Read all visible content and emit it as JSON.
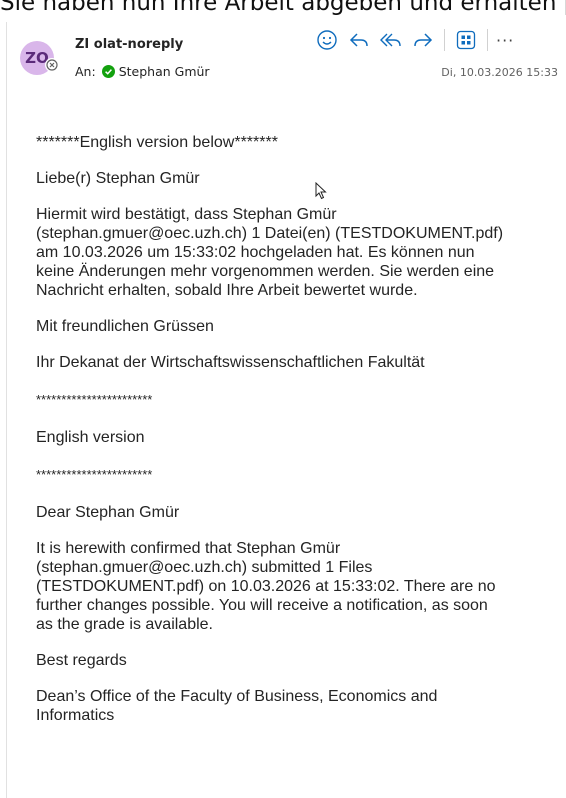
{
  "banner": "Sie haben nun Ihre Arbeit abgeben und erhalten p",
  "email": {
    "avatar_initials": "ZO",
    "sender": "ZI olat-noreply",
    "to_label": "An:",
    "recipient": "Stephan Gmür",
    "date": "Di, 10.03.2026 15:33"
  },
  "toolbar": {
    "icons": [
      "smiley-icon",
      "reply-icon",
      "reply-all-icon",
      "forward-icon",
      "apps-icon",
      "more-icon"
    ],
    "more_label": "···"
  },
  "body": {
    "line1": "*******English version below*******",
    "greeting": "Liebe(r) Stephan Gmür",
    "de_line1": "Hiermit wird bestätigt, dass Stephan Gmür",
    "de_line2": "(stephan.gmuer@oec.uzh.ch) 1 Datei(en) (TESTDOKUMENT.pdf)",
    "de_line3": "am 10.03.2026 um 15:33:02 hochgeladen hat. Es können nun",
    "de_line4": "keine Änderungen mehr vorgenommen werden. Sie werden eine",
    "de_line5": "Nachricht erhalten, sobald Ihre Arbeit bewertet wurde.",
    "de_closing": "Mit freundlichen Grüssen",
    "de_signature": "Ihr Dekanat der Wirtschaftswissenschaftlichen Fakultät",
    "stars1": "***********************",
    "en_heading": "English version",
    "stars2": "***********************",
    "en_greeting": "Dear Stephan Gmür",
    "en_line1": "It is herewith confirmed that Stephan Gmür",
    "en_line2": "(stephan.gmuer@oec.uzh.ch) submitted 1 Files",
    "en_line3": "(TESTDOKUMENT.pdf) on 10.03.2026 at 15:33:02. There are no",
    "en_line4": "further changes possible. You will receive a notification, as soon",
    "en_line5": "as the grade is available.",
    "en_closing": "Best regards",
    "en_sig1": "Dean’s Office of the Faculty of Business, Economics and",
    "en_sig2": "Informatics"
  },
  "colors": {
    "avatar_bg": "#d9b6ea",
    "accent": "#0f6cbd",
    "presence_green": "#13a10e"
  }
}
